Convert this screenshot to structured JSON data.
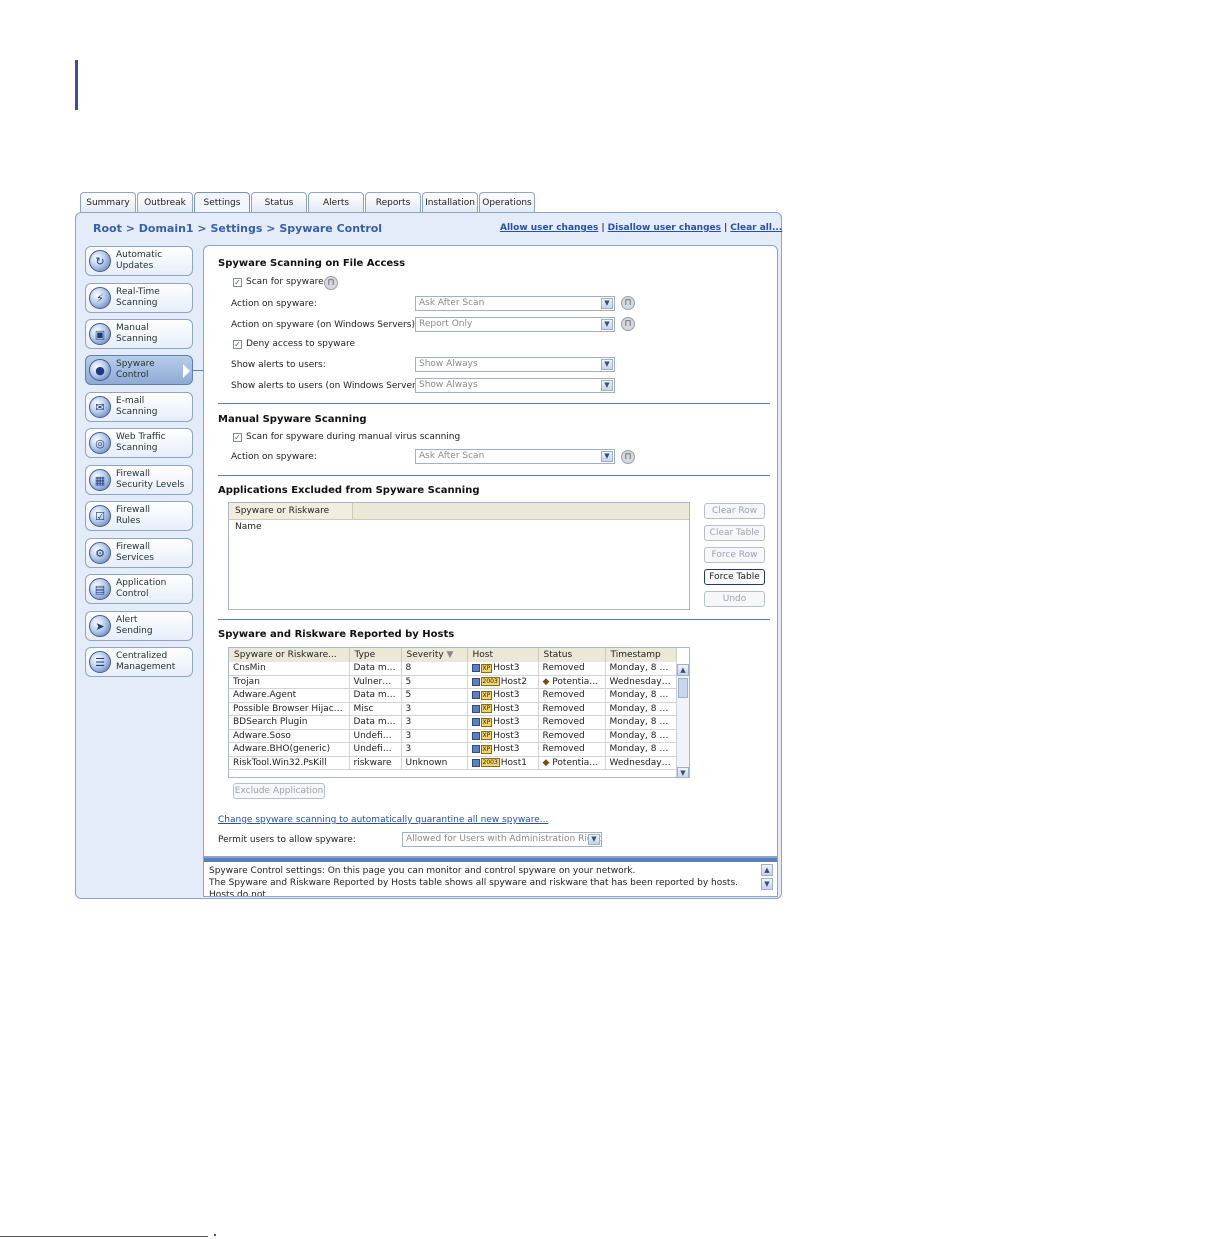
{
  "tabs": [
    "Summary",
    "Outbreak",
    "Settings",
    "Status",
    "Alerts",
    "Reports",
    "Installation",
    "Operations"
  ],
  "breadcrumb": {
    "root": "Root",
    "domain": "Domain1",
    "settings": "Settings",
    "current": "Spyware Control",
    "sep": ">"
  },
  "toplinks": {
    "allow": "Allow user changes",
    "disallow": "Disallow user changes",
    "clear": "Clear all...",
    "bar": "|"
  },
  "nav": [
    {
      "line1": "Automatic",
      "line2": "Updates",
      "icon": "update-icon"
    },
    {
      "line1": "Real-Time",
      "line2": "Scanning",
      "icon": "realtime-scan-icon"
    },
    {
      "line1": "Manual",
      "line2": "Scanning",
      "icon": "manual-scan-icon"
    },
    {
      "line1": "Spyware",
      "line2": "Control",
      "icon": "spyware-icon"
    },
    {
      "line1": "E-mail",
      "line2": "Scanning",
      "icon": "email-icon"
    },
    {
      "line1": "Web Traffic",
      "line2": "Scanning",
      "icon": "web-traffic-icon"
    },
    {
      "line1": "Firewall",
      "line2": "Security Levels",
      "icon": "firewall-levels-icon"
    },
    {
      "line1": "Firewall",
      "line2": "Rules",
      "icon": "firewall-rules-icon"
    },
    {
      "line1": "Firewall",
      "line2": "Services",
      "icon": "firewall-services-icon"
    },
    {
      "line1": "Application",
      "line2": "Control",
      "icon": "application-icon"
    },
    {
      "line1": "Alert",
      "line2": "Sending",
      "icon": "alert-icon"
    },
    {
      "line1": "Centralized",
      "line2": "Management",
      "icon": "centralized-icon"
    }
  ],
  "file_access": {
    "heading": "Spyware Scanning on File Access",
    "scan_label": "Scan for spyware",
    "scan_checked": true,
    "action_label": "Action on spyware:",
    "action_value": "Ask After Scan",
    "action_servers_label": "Action on spyware (on Windows Servers):",
    "action_servers_value": "Report Only",
    "deny_label": "Deny access to spyware",
    "deny_checked": true,
    "alerts_label": "Show alerts to users:",
    "alerts_value": "Show Always",
    "alerts_servers_label": "Show alerts to users (on Windows Servers):",
    "alerts_servers_value": "Show Always"
  },
  "manual": {
    "heading": "Manual Spyware Scanning",
    "scan_label": "Scan for spyware during manual virus scanning",
    "scan_checked": true,
    "action_label": "Action on spyware:",
    "action_value": "Ask After Scan"
  },
  "excluded": {
    "heading": "Applications Excluded from Spyware Scanning",
    "column": "Spyware or Riskware Name",
    "buttons": {
      "clear_row": "Clear Row",
      "clear_table": "Clear Table",
      "force_row": "Force Row",
      "force_table": "Force Table",
      "undo": "Undo"
    }
  },
  "reported": {
    "heading": "Spyware and Riskware Reported by Hosts",
    "columns": [
      "Spyware or Riskware...",
      "Type",
      "Severity",
      "Host",
      "Status",
      "Timestamp"
    ],
    "rows": [
      {
        "name": "CnsMin",
        "type": "Data miner",
        "severity": "8",
        "os": "XP",
        "host": "Host3",
        "status": "Removed",
        "warn": false,
        "time": "Monday, 8 O..."
      },
      {
        "name": "Trojan",
        "type": "Vulnerab...",
        "severity": "5",
        "os": "2003",
        "host": "Host2",
        "status": "Potentiall...",
        "warn": true,
        "time": "Wednesday,..."
      },
      {
        "name": "Adware.Agent",
        "type": "Data miner",
        "severity": "5",
        "os": "XP",
        "host": "Host3",
        "status": "Removed",
        "warn": false,
        "time": "Monday, 8 O..."
      },
      {
        "name": "Possible Browser Hijack a...",
        "type": "Misc",
        "severity": "3",
        "os": "XP",
        "host": "Host3",
        "status": "Removed",
        "warn": false,
        "time": "Monday, 8 O..."
      },
      {
        "name": "BDSearch Plugin",
        "type": "Data miner",
        "severity": "3",
        "os": "XP",
        "host": "Host3",
        "status": "Removed",
        "warn": false,
        "time": "Monday, 8 O..."
      },
      {
        "name": "Adware.Soso",
        "type": "Undefined",
        "severity": "3",
        "os": "XP",
        "host": "Host3",
        "status": "Removed",
        "warn": false,
        "time": "Monday, 8 O..."
      },
      {
        "name": "Adware.BHO(generic)",
        "type": "Undefined",
        "severity": "3",
        "os": "XP",
        "host": "Host3",
        "status": "Removed",
        "warn": false,
        "time": "Monday, 8 O..."
      },
      {
        "name": "RiskTool.Win32.PsKill",
        "type": "riskware",
        "severity": "Unknown",
        "os": "2003",
        "host": "Host1",
        "status": "Potentiall...",
        "warn": true,
        "time": "Wednesday,..."
      }
    ],
    "exclude_button": "Exclude Application"
  },
  "quarantine_link": "Change spyware scanning to automatically quarantine all new spyware...",
  "permit": {
    "label": "Permit users to allow spyware:",
    "value": "Allowed for Users with Administration Rights"
  },
  "help_text": [
    "Spyware Control settings: On this page you can monitor and control spyware on your network.",
    "The Spyware and Riskware Reported by Hosts table shows all spyware and riskware that has been reported by hosts. Hosts do not"
  ]
}
